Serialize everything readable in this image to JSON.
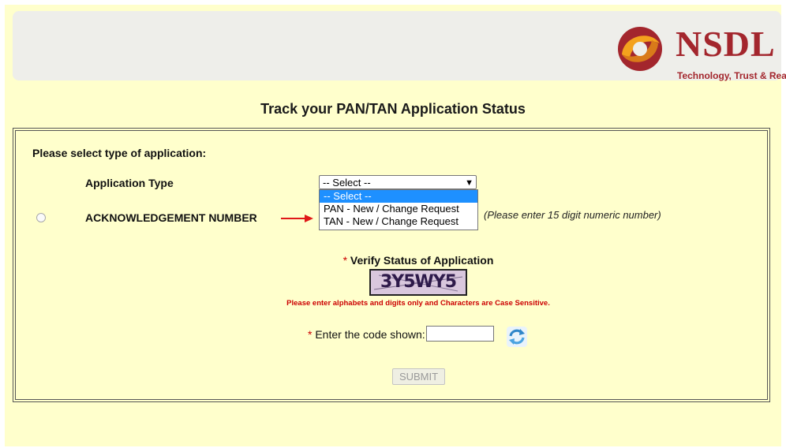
{
  "brand": {
    "name": "NSDL",
    "tagline": "Technology, Trust & Reach",
    "color": "#a3262d",
    "accent_orange": "#f4a21d"
  },
  "page": {
    "title": "Track your PAN/TAN Application Status"
  },
  "form": {
    "section_label": "Please select type of application:",
    "application_type_label": "Application Type",
    "select": {
      "current_value": "-- Select --",
      "options": [
        "-- Select --",
        "PAN - New / Change Request",
        "TAN - New / Change Request"
      ],
      "highlighted_index": 0
    },
    "ack_label": "ACKNOWLEDGEMENT NUMBER",
    "ack_hint": "(Please enter 15 digit numeric number)",
    "verify_required_mark": "*",
    "verify_label": "Verify Status of Application",
    "captcha_text": "3Y5WY5",
    "captcha_note": "Please enter alphabets and digits only and Characters are Case Sensitive.",
    "code_required_mark": "*",
    "code_label": "Enter the code shown:",
    "code_value": "",
    "submit_label": "SUBMIT"
  },
  "icons": {
    "logo": "nsdl-logo-icon",
    "refresh": "refresh-captcha-icon",
    "arrow": "red-arrow-icon",
    "chevron": "chevron-down-icon"
  }
}
